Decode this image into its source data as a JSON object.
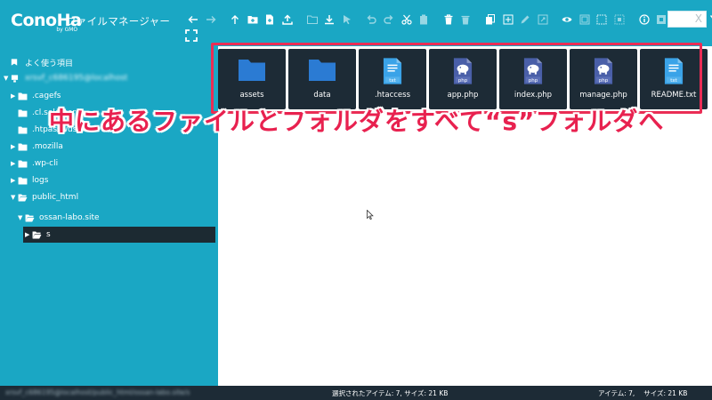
{
  "header": {
    "logo_text": "ConoHa",
    "logo_sub": "by GMO",
    "app_title": "ファイルマネージャー",
    "search_clear": "X"
  },
  "toolbar": {
    "icons": [
      "back-icon",
      "forward-icon",
      "up-icon",
      "new-folder-icon",
      "new-file-icon",
      "upload-icon",
      "open-folder-icon",
      "download-icon",
      "select-icon",
      "undo-icon",
      "redo-icon",
      "cut-icon",
      "paste-icon",
      "delete-icon",
      "trash-icon",
      "copy-icon",
      "duplicate-icon",
      "rename-icon",
      "resize-icon",
      "preview-icon",
      "select-all-icon",
      "select-none-icon",
      "invert-select-icon",
      "info-icon",
      "extract-icon",
      "archive-icon",
      "view-toggle-icon",
      "sort-icon"
    ]
  },
  "sidebar": {
    "favorites_label": "よく使う項目",
    "root_label": "xrsvf_c686195@localhost",
    "items": [
      {
        "label": ".cagefs"
      },
      {
        "label": ".cl.selector"
      },
      {
        "label": ".htpasswds"
      },
      {
        "label": ".mozilla"
      },
      {
        "label": ".wp-cli"
      },
      {
        "label": "logs"
      },
      {
        "label": "public_html"
      },
      {
        "label": "ossan-labo.site"
      },
      {
        "label": "s"
      }
    ]
  },
  "files": [
    {
      "name": "assets",
      "kind": "folder"
    },
    {
      "name": "data",
      "kind": "folder"
    },
    {
      "name": ".htaccess",
      "kind": "txt"
    },
    {
      "name": "app.php",
      "kind": "php"
    },
    {
      "name": "index.php",
      "kind": "php"
    },
    {
      "name": "manage.php",
      "kind": "php"
    },
    {
      "name": "README.txt",
      "kind": "txt"
    }
  ],
  "file_badges": {
    "txt": "txt",
    "php": "php"
  },
  "instruction": "中にあるファイルとフォルダをすべて“s”フォルダへ",
  "status": {
    "path": "xrsvf_c686195@localhost/public_html/ossan-labo.site/s",
    "selected": "選択されたアイテム: 7, サイズ: 21 KB",
    "total": "アイテム: 7,　 サイズ: 21 KB"
  },
  "colors": {
    "header": "#1aa7c4",
    "sidebar": "#1aa7c4",
    "tile": "#1d2b36",
    "folder": "#2b7bd3",
    "txt": "#3aa3e8",
    "php": "#4a5fa8",
    "highlight": "#ea2d55",
    "instruction": "#e8214f",
    "statusbar": "#1d2b36"
  }
}
